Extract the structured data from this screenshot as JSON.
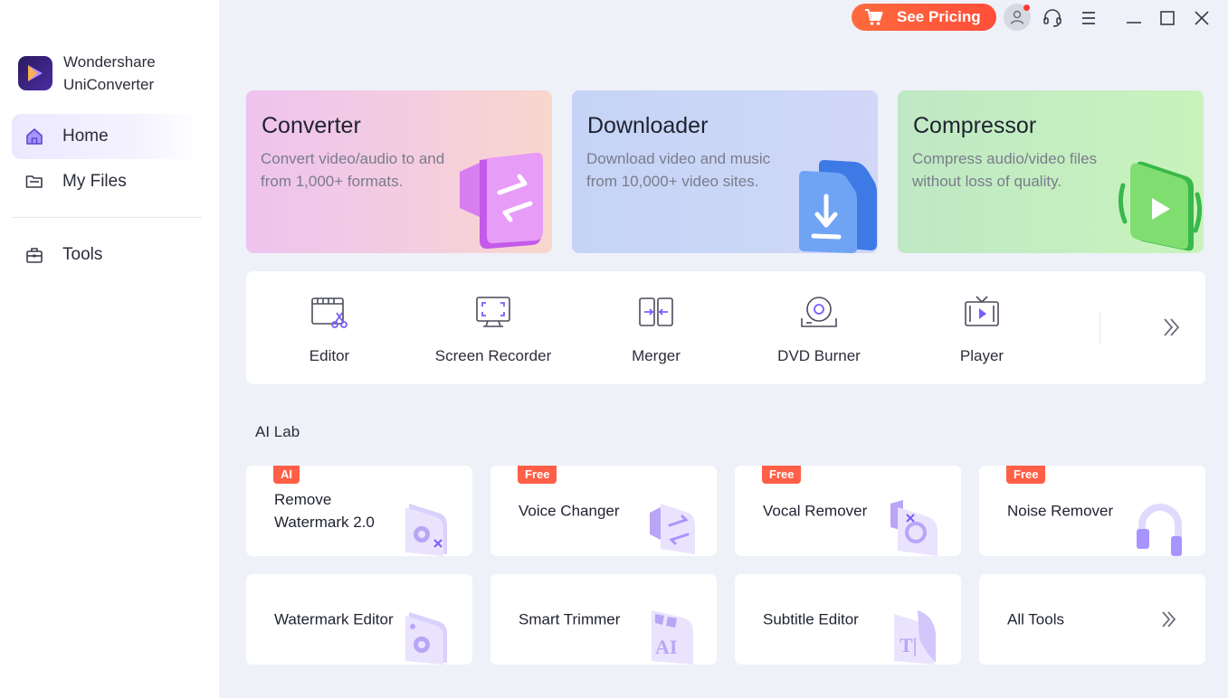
{
  "app": {
    "name_line1": "Wondershare",
    "name_line2": "UniConverter"
  },
  "sidebar": {
    "items": [
      {
        "label": "Home",
        "icon": "home-icon",
        "active": true
      },
      {
        "label": "My Files",
        "icon": "folder-icon",
        "active": false
      },
      {
        "label": "Tools",
        "icon": "toolbox-icon",
        "active": false
      }
    ]
  },
  "titlebar": {
    "pricing_label": "See Pricing",
    "icons": [
      "cart-icon",
      "user-icon",
      "headset-icon",
      "menu-icon",
      "minimize-icon",
      "maximize-icon",
      "close-icon"
    ]
  },
  "features": [
    {
      "title": "Converter",
      "desc": "Convert video/audio to and from 1,000+ formats."
    },
    {
      "title": "Downloader",
      "desc": "Download video and music from 10,000+ video sites."
    },
    {
      "title": "Compressor",
      "desc": "Compress audio/video files without loss of quality."
    }
  ],
  "tools": [
    {
      "label": "Editor",
      "icon": "editor-icon"
    },
    {
      "label": "Screen Recorder",
      "icon": "screen-recorder-icon"
    },
    {
      "label": "Merger",
      "icon": "merger-icon"
    },
    {
      "label": "DVD Burner",
      "icon": "dvd-burner-icon"
    },
    {
      "label": "Player",
      "icon": "player-icon"
    }
  ],
  "ai_lab": {
    "title": "AI Lab",
    "tiles": [
      {
        "label": "Remove Watermark 2.0",
        "badge": "AI"
      },
      {
        "label": "Voice Changer",
        "badge": "Free"
      },
      {
        "label": "Vocal Remover",
        "badge": "Free"
      },
      {
        "label": "Noise Remover",
        "badge": "Free"
      },
      {
        "label": "Watermark Editor",
        "badge": ""
      },
      {
        "label": "Smart Trimmer",
        "badge": ""
      },
      {
        "label": "Subtitle Editor",
        "badge": ""
      },
      {
        "label": "All Tools",
        "badge": ""
      }
    ]
  },
  "colors": {
    "accent": "#7b5cff",
    "pricing": "#ff5a3c",
    "badge": "#ff5f46",
    "background": "#eff1f9"
  }
}
